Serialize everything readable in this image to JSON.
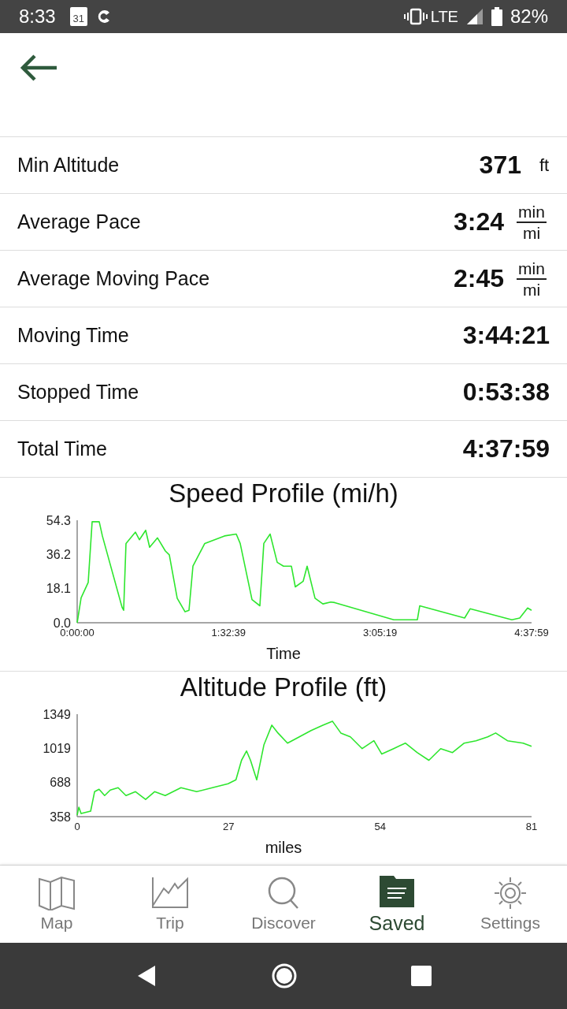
{
  "status_bar": {
    "time": "8:33",
    "calendar_day": "31",
    "network": "LTE",
    "battery": "82%"
  },
  "stats": [
    {
      "kind": "plain",
      "label": "Min Altitude",
      "value": "371",
      "unit": "ft"
    },
    {
      "kind": "fraction",
      "label": "Average Pace",
      "value": "3:24",
      "unit_top": "min",
      "unit_bottom": "mi"
    },
    {
      "kind": "fraction",
      "label": "Average Moving Pace",
      "value": "2:45",
      "unit_top": "min",
      "unit_bottom": "mi"
    },
    {
      "kind": "plain",
      "label": "Moving Time",
      "value": "3:44:21"
    },
    {
      "kind": "plain",
      "label": "Stopped Time",
      "value": "0:53:38"
    },
    {
      "kind": "plain",
      "label": "Total Time",
      "value": "4:37:59"
    }
  ],
  "charts": [
    {
      "chart_data": {
        "type": "line",
        "title": "Speed Profile (mi/h)",
        "xlabel": "Time",
        "x": [
          0,
          145,
          405,
          549,
          809,
          925,
          1648,
          1705,
          1792,
          2139,
          2284,
          2515,
          2659,
          2948,
          3237,
          3382,
          3671,
          3960,
          4105,
          4249,
          4683,
          5405,
          5839,
          5984,
          6417,
          6706,
          6851,
          7082,
          7342,
          7573,
          7862,
          8007,
          8296,
          8441,
          8730,
          9019,
          9308,
          9452,
          11620,
          12487,
          12574,
          14222,
          14424,
          15956,
          16245,
          16534,
          16679
        ],
        "series": [
          {
            "color": "#2ee62e",
            "values": [
              0,
              13.2,
              21.4,
              53.5,
              53.5,
              46,
              8.2,
              6.6,
              42,
              48,
              44,
              49,
              40,
              45,
              38,
              36,
              13,
              5.8,
              6.6,
              30,
              42,
              46,
              47,
              42,
              12.3,
              9,
              42,
              47,
              32,
              30,
              30,
              19,
              22,
              30,
              13,
              10,
              11,
              10.7,
              1.6,
              1.6,
              9,
              2.5,
              7.4,
              1.6,
              2.5,
              7.8,
              6.6
            ]
          }
        ],
        "xlim": [
          0,
          16679
        ],
        "ylim": [
          0,
          54.3
        ],
        "xticks": [
          {
            "value": 0,
            "label": "0:00:00"
          },
          {
            "value": 5559,
            "label": "1:32:39"
          },
          {
            "value": 11119,
            "label": "3:05:19"
          },
          {
            "value": 16679,
            "label": "4:37:59"
          }
        ],
        "yticks": [
          {
            "value": 0,
            "label": "0.0"
          },
          18.1,
          36.2,
          54.3
        ]
      }
    },
    {
      "chart_data": {
        "type": "line",
        "title": "Altitude Profile (ft)",
        "xlabel": "miles",
        "x": [
          0,
          0.3,
          0.7,
          2.4,
          3.1,
          3.9,
          4.9,
          5.9,
          7.3,
          8.7,
          10.4,
          12.2,
          13.8,
          15.7,
          18.5,
          21.3,
          24.1,
          26.9,
          28.3,
          29.3,
          30.2,
          30.9,
          32.0,
          33.3,
          34.7,
          35.8,
          37.5,
          39.6,
          41.7,
          43.8,
          45.5,
          47.0,
          48.7,
          50.8,
          52.9,
          54.3,
          56.4,
          58.5,
          60.6,
          62.7,
          64.8,
          66.9,
          69.0,
          71.1,
          73.2,
          74.6,
          76.7,
          79.5,
          81
        ],
        "series": [
          {
            "color": "#2ee62e",
            "values": [
              373,
              449,
              388,
              411,
              600,
              623,
              562,
              615,
              638,
              562,
              600,
              524,
              600,
              562,
              638,
              600,
              638,
              676,
              714,
              903,
              993,
              903,
              714,
              1054,
              1243,
              1167,
              1069,
              1130,
              1191,
              1243,
              1281,
              1167,
              1130,
              1016,
              1092,
              963,
              1016,
              1069,
              978,
              903,
              1016,
              978,
              1069,
              1092,
              1130,
              1167,
              1092,
              1069,
              1039
            ]
          }
        ],
        "xlim": [
          0,
          81
        ],
        "ylim": [
          358,
          1349
        ],
        "xticks": [
          0,
          27,
          54,
          81
        ],
        "yticks": [
          358,
          688,
          1019,
          1349
        ]
      }
    }
  ],
  "nav": [
    {
      "label": "Map",
      "selected": false
    },
    {
      "label": "Trip",
      "selected": false
    },
    {
      "label": "Discover",
      "selected": false
    },
    {
      "label": "Saved",
      "selected": true
    },
    {
      "label": "Settings",
      "selected": false
    }
  ]
}
